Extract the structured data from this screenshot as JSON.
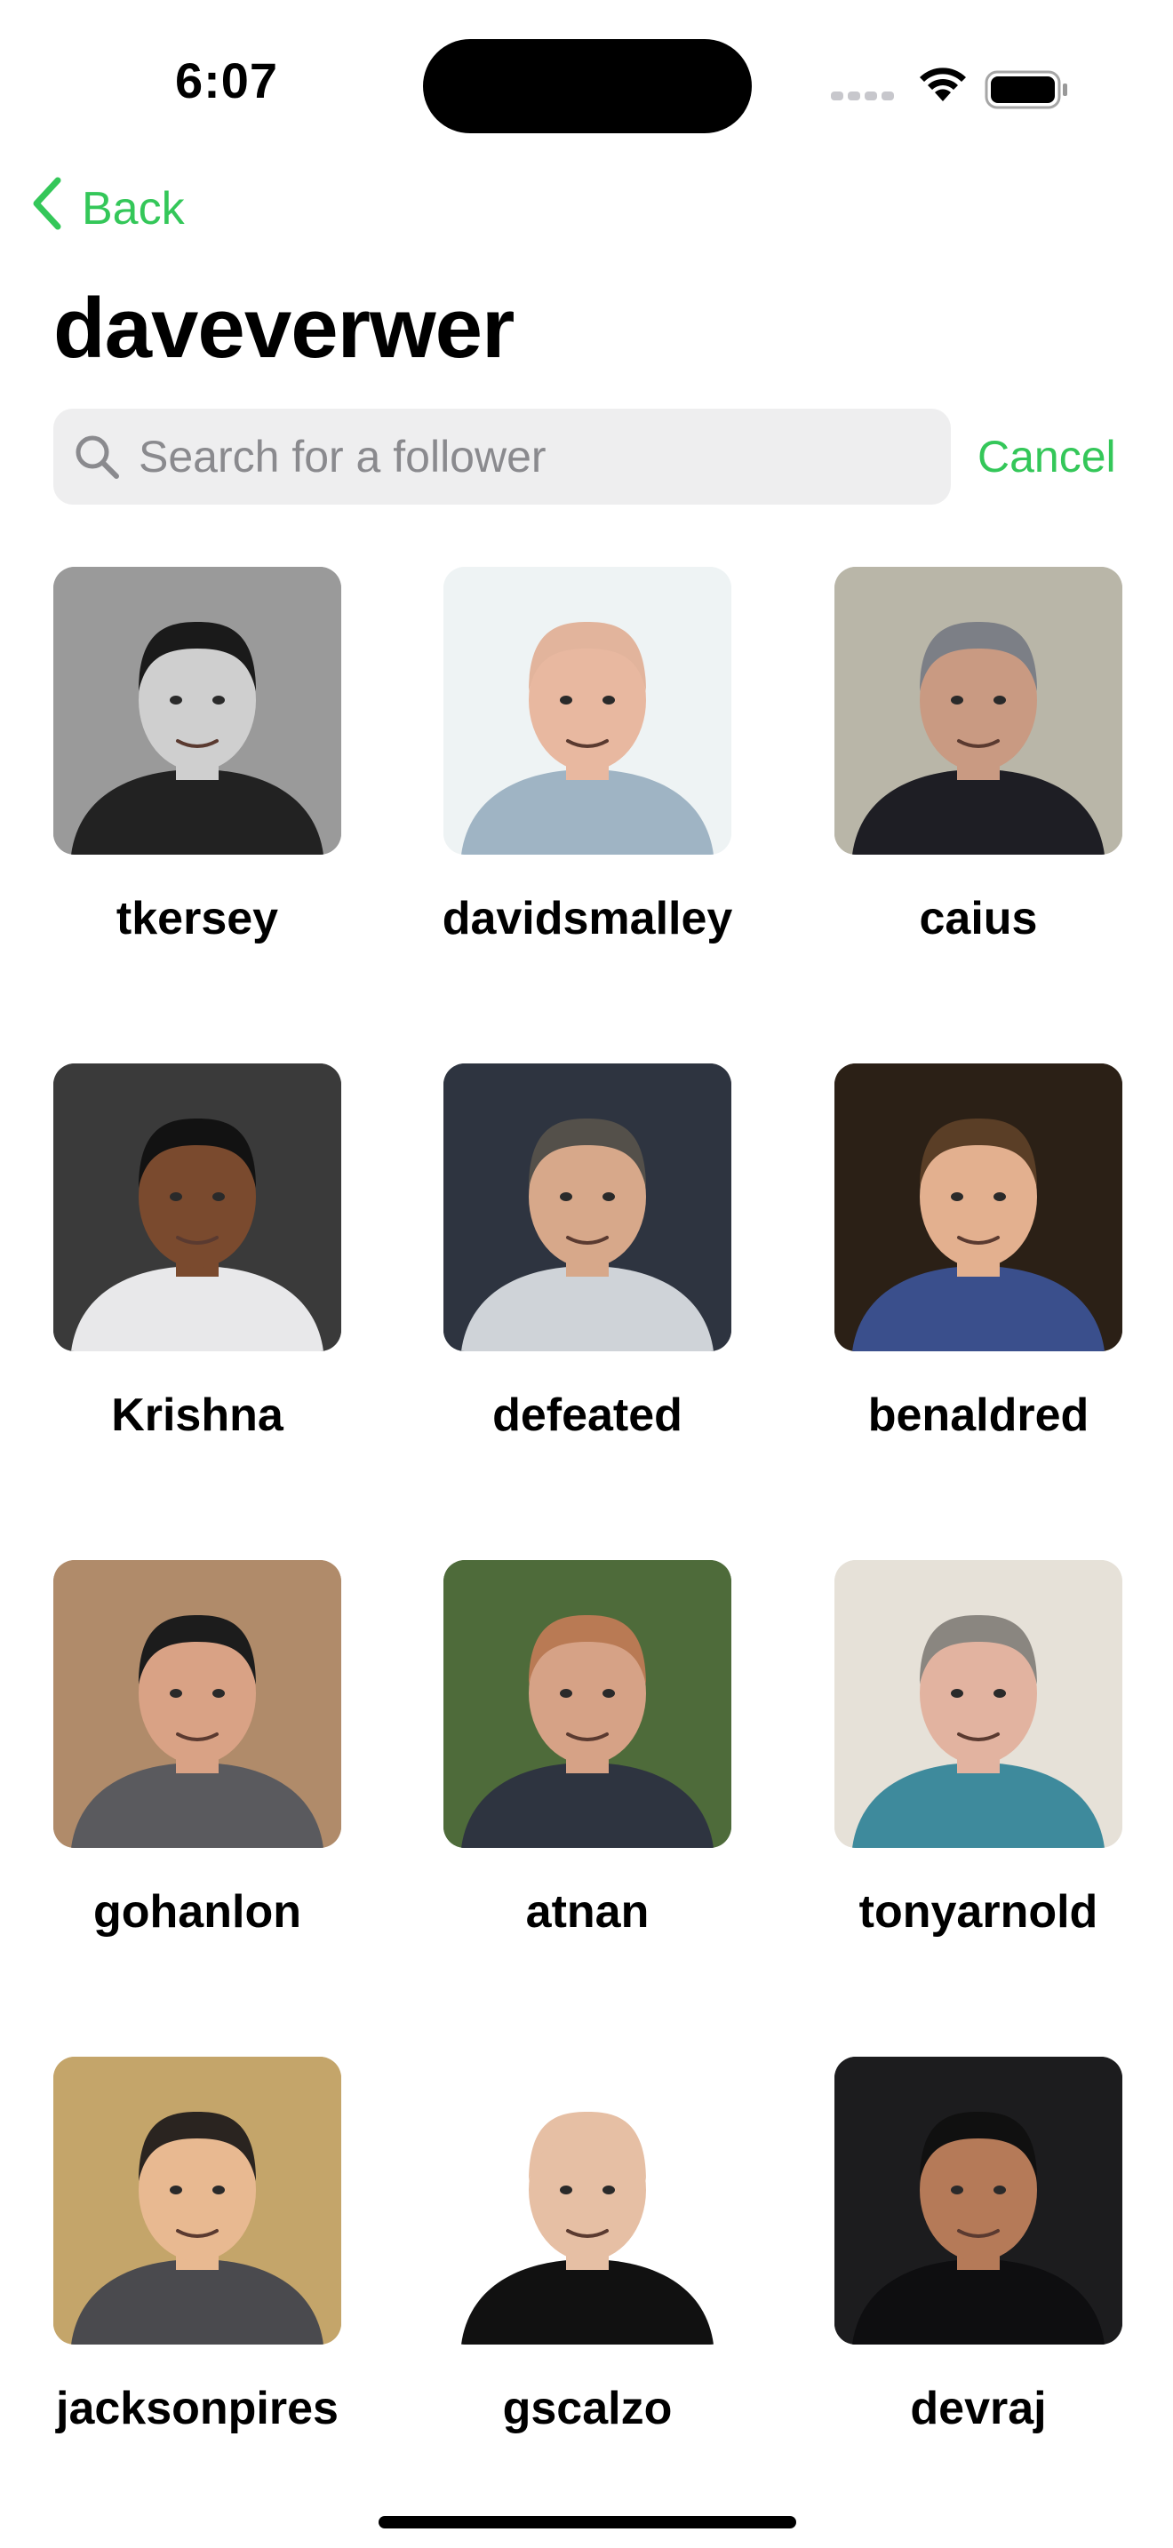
{
  "status_bar": {
    "time": "6:07"
  },
  "nav": {
    "back_label": "Back"
  },
  "page": {
    "title": "daveverwer"
  },
  "search": {
    "placeholder": "Search for a follower",
    "cancel_label": "Cancel"
  },
  "followers": [
    {
      "username": "tkersey",
      "bg": "#9a9a9a",
      "skin": "#cfcfcf",
      "hair": "#1a1a1a",
      "shirt": "#222222"
    },
    {
      "username": "davidsmalley",
      "bg": "#eef3f4",
      "skin": "#e8b8a0",
      "hair": "#e2b49c",
      "shirt": "#9fb4c4"
    },
    {
      "username": "caius",
      "bg": "#b9b6a8",
      "skin": "#c99a82",
      "hair": "#7c7f86",
      "shirt": "#1e1e24"
    },
    {
      "username": "Krishna",
      "bg": "#3a3a3a",
      "skin": "#7a4a2e",
      "hair": "#121212",
      "shirt": "#e8e8ea"
    },
    {
      "username": "defeated",
      "bg": "#2e3440",
      "skin": "#d7a88a",
      "hair": "#54504a",
      "shirt": "#cfd3d8"
    },
    {
      "username": "benaldred",
      "bg": "#2b2016",
      "skin": "#e3b08f",
      "hair": "#5a3e26",
      "shirt": "#3a4f8c"
    },
    {
      "username": "gohanlon",
      "bg": "#b08b6a",
      "skin": "#d9a285",
      "hair": "#1c1c1c",
      "shirt": "#5a5a5e"
    },
    {
      "username": "atnan",
      "bg": "#4e6b3a",
      "skin": "#d6a286",
      "hair": "#b97a54",
      "shirt": "#2e3440"
    },
    {
      "username": "tonyarnold",
      "bg": "#e6e1d8",
      "skin": "#e2b3a0",
      "hair": "#8a8680",
      "shirt": "#3e8a9c"
    },
    {
      "username": "jacksonpires",
      "bg": "#c4a56a",
      "skin": "#e8b991",
      "hair": "#2a2420",
      "shirt": "#4a4a4e"
    },
    {
      "username": "gscalzo",
      "bg": "#ffffff",
      "skin": "#e6bfa4",
      "hair": "#e6bfa4",
      "shirt": "#111111"
    },
    {
      "username": "devraj",
      "bg": "#1c1c1e",
      "skin": "#b57a58",
      "hair": "#101010",
      "shirt": "#0e0e10"
    }
  ]
}
